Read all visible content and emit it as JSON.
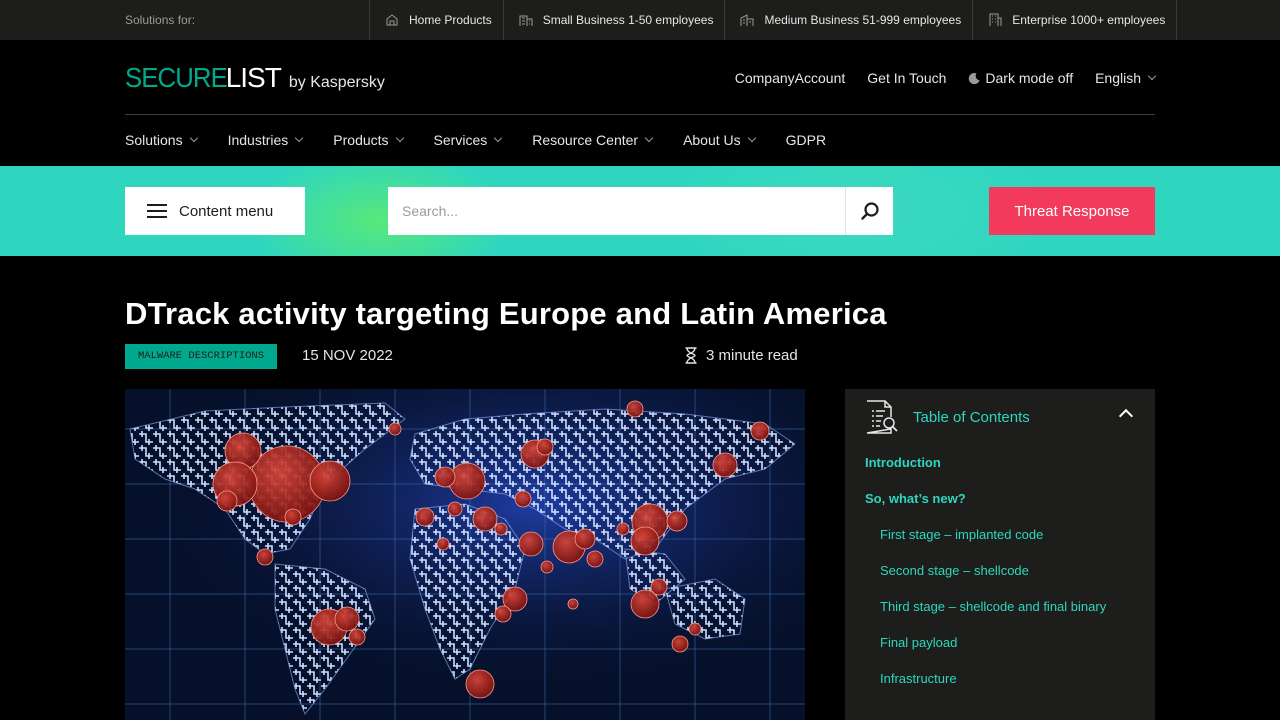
{
  "topbar": {
    "solutions_label": "Solutions for:",
    "segments": [
      {
        "icon": "home-icon",
        "label": "Home Products"
      },
      {
        "icon": "small-business-icon",
        "label": "Small Business 1-50 employees"
      },
      {
        "icon": "medium-business-icon",
        "label": "Medium Business 51-999 employees"
      },
      {
        "icon": "enterprise-icon",
        "label": "Enterprise 1000+ employees"
      }
    ]
  },
  "header": {
    "logo_secure": "SECURE",
    "logo_list": "LIST",
    "logo_by": "by Kaspersky",
    "company_account": "CompanyAccount",
    "get_in_touch": "Get In Touch",
    "dark_mode": "Dark mode off",
    "language": "English",
    "nav": [
      "Solutions",
      "Industries",
      "Products",
      "Services",
      "Resource Center",
      "About Us",
      "GDPR"
    ]
  },
  "band": {
    "content_menu": "Content menu",
    "search_placeholder": "Search...",
    "threat_response": "Threat Response"
  },
  "article": {
    "title": "DTrack activity targeting Europe and Latin America",
    "tag": "MALWARE DESCRIPTIONS",
    "date": "15 NOV 2022",
    "read_time": "3 minute read"
  },
  "toc": {
    "title": "Table of Contents",
    "items": [
      {
        "label": "Introduction",
        "level": 1
      },
      {
        "label": "So, what’s new?",
        "level": 1
      },
      {
        "label": "First stage – implanted code",
        "level": 2
      },
      {
        "label": "Second stage – shellcode",
        "level": 2
      },
      {
        "label": "Third stage – shellcode and final binary",
        "level": 2
      },
      {
        "label": "Final payload",
        "level": 2
      },
      {
        "label": "Infrastructure",
        "level": 2
      }
    ]
  },
  "colors": {
    "accent_teal": "#00a88e",
    "band_teal": "#2ed6bf",
    "threat_red": "#f23a5c",
    "topbar_bg": "#1d1d1b"
  }
}
